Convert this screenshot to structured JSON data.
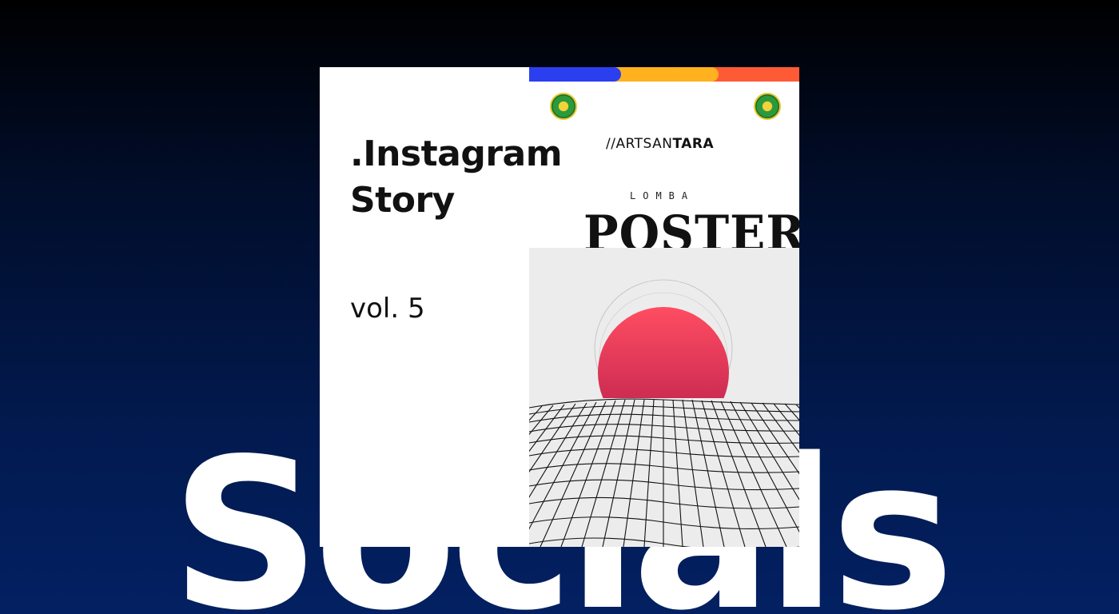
{
  "background": {
    "word": "Socials",
    "gradient_top": "#000000",
    "gradient_bottom": "#032062"
  },
  "card": {
    "title_line1": ".Instagram",
    "title_line2": "Story",
    "volume": "vol. 5",
    "brand_prefix": "//ARTSAN",
    "brand_suffix": "TARA",
    "event_label": "LOMBA",
    "event_title": "POSTER",
    "accent_colors": [
      "#2b3ff0",
      "#ffb21e",
      "#ff5a36"
    ],
    "sun_colors": [
      "#ff4d62",
      "#b81e4c"
    ]
  }
}
